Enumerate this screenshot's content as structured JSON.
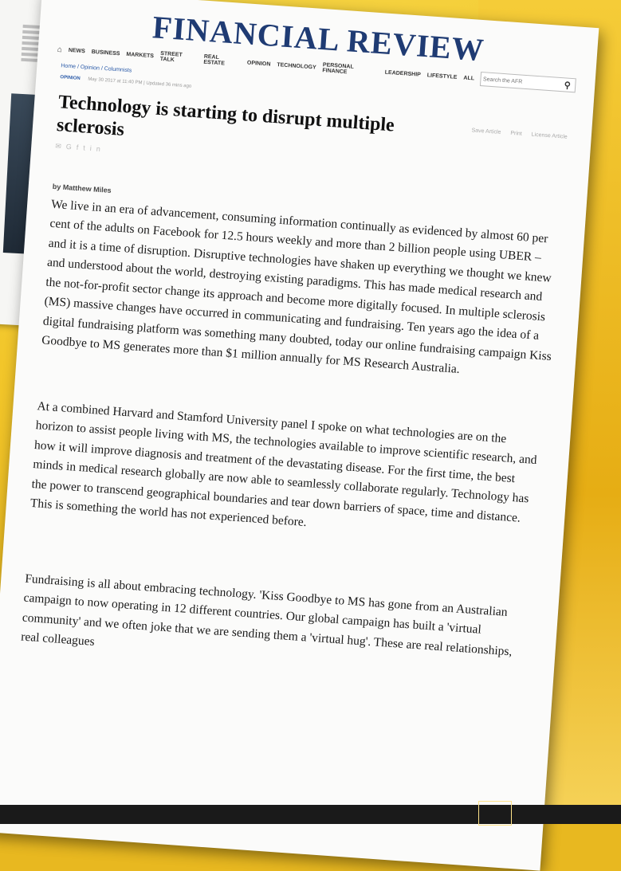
{
  "site": {
    "masthead": "FINANCIAL REVIEW"
  },
  "nav": {
    "items": [
      "NEWS",
      "BUSINESS",
      "MARKETS",
      "STREET TALK",
      "REAL ESTATE",
      "OPINION",
      "TECHNOLOGY",
      "PERSONAL FINANCE",
      "LEADERSHIP",
      "LIFESTYLE",
      "ALL"
    ],
    "search_placeholder": "Search the AFR"
  },
  "breadcrumb": "Home / Opinion / Columnists",
  "meta": {
    "tag": "OPINION",
    "date": "May 30 2017 at 11:40 PM",
    "updated": "Updated 36 mins ago"
  },
  "article": {
    "title": "Technology is starting to disrupt multiple sclerosis",
    "tools": [
      "Save Article",
      "Print",
      "License Article"
    ],
    "byline": "by Matthew Miles",
    "paragraphs": [
      "We live in an era of advancement, consuming information continually as evidenced by almost 60 per cent of the adults on Facebook for 12.5 hours weekly and more than 2 billion people using UBER – and it is a time of disruption. Disruptive technologies have shaken up everything we thought we knew and understood about the world, destroying existing paradigms. This has made medical research and the not-for-profit sector change its approach and become more digitally focused. In multiple sclerosis (MS) massive changes have occurred in communicating and fundraising. Ten years ago the idea of a digital fundraising platform was something many doubted, today our online fundraising campaign Kiss Goodbye to MS generates more than $1 million annually for MS Research Australia.",
      "At a combined Harvard and Stamford University panel I spoke on what technologies are on the horizon to assist people living with MS, the technologies available to improve scientific research, and how it will improve diagnosis and treatment of the devastating disease. For the first time, the best minds in medical research globally are now able to seamlessly collaborate regularly. Technology has the power to transcend geographical boundaries and tear down barriers of space, time and distance. This is something the world has not experienced before.",
      "Fundraising is all about embracing technology. 'Kiss Goodbye to MS has gone from an Australian campaign to now operating in 12 different countries. Our global campaign has built a 'virtual community' and we often joke that we are sending them a 'virtual hug'. These are real relationships, real colleagues"
    ]
  },
  "colors": {
    "masthead": "#1f3b73",
    "background": "#f2c62a",
    "link": "#2a5aa8"
  }
}
